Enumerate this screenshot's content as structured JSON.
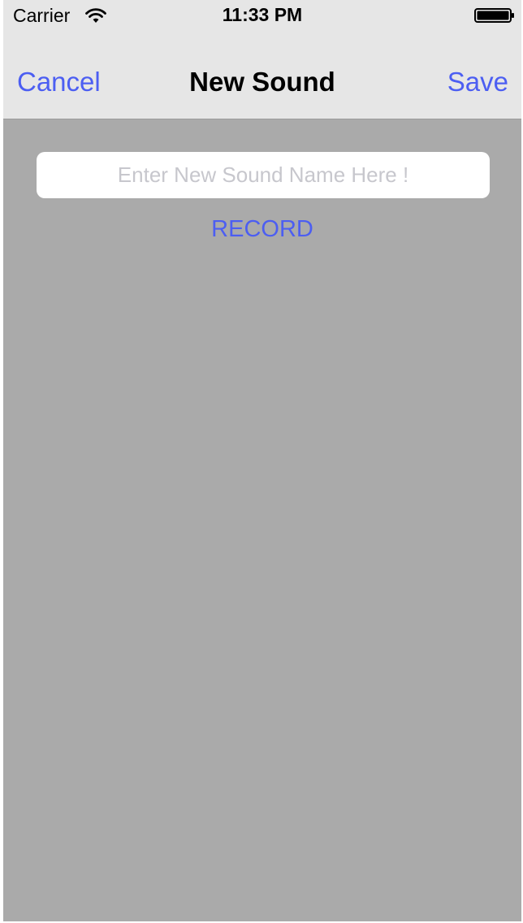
{
  "status_bar": {
    "carrier": "Carrier",
    "time": "11:33 PM",
    "wifi_icon": "wifi-icon",
    "battery_icon": "battery-full-icon"
  },
  "nav": {
    "cancel_label": "Cancel",
    "title": "New Sound",
    "save_label": "Save"
  },
  "form": {
    "name_value": "",
    "name_placeholder": "Enter New Sound Name Here !",
    "record_label": "RECORD"
  },
  "colors": {
    "accent": "#4c5ef2",
    "nav_background": "#e6e6e6",
    "content_background": "#aaaaaa",
    "placeholder": "#c7c7cd"
  }
}
